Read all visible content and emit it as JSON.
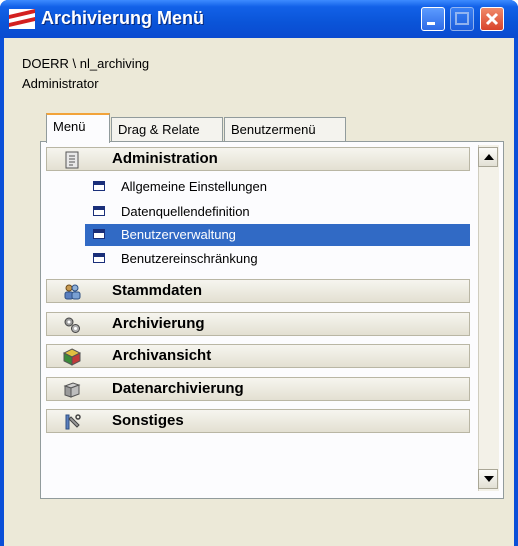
{
  "window": {
    "title": "Archivierung Menü",
    "controls": [
      "minimize",
      "maximize",
      "close"
    ]
  },
  "session": {
    "user": "DOERR \\ nl_archiving",
    "role": "Administrator"
  },
  "tabs": [
    {
      "label": "Menü",
      "active": true
    },
    {
      "label": "Drag & Relate",
      "active": false
    },
    {
      "label": "Benutzermenü",
      "active": false
    }
  ],
  "menu": {
    "groups": [
      {
        "label": "Administration",
        "icon": "document-icon",
        "expanded": true,
        "items": [
          {
            "label": "Allgemeine Einstellungen",
            "selected": false
          },
          {
            "label": "Datenquellendefinition",
            "selected": false
          },
          {
            "label": "Benutzerverwaltung",
            "selected": true
          },
          {
            "label": "Benutzereinschränkung",
            "selected": false
          }
        ]
      },
      {
        "label": "Stammdaten",
        "icon": "users-icon"
      },
      {
        "label": "Archivierung",
        "icon": "gears-icon"
      },
      {
        "label": "Archivansicht",
        "icon": "cube-icon"
      },
      {
        "label": "Datenarchivierung",
        "icon": "archive-box-icon"
      },
      {
        "label": "Sonstiges",
        "icon": "tools-icon"
      }
    ]
  },
  "colors": {
    "titlebar": "#0a54d8",
    "selection": "#316ac5",
    "tab_accent": "#f2a33a",
    "face": "#ece9d8"
  }
}
